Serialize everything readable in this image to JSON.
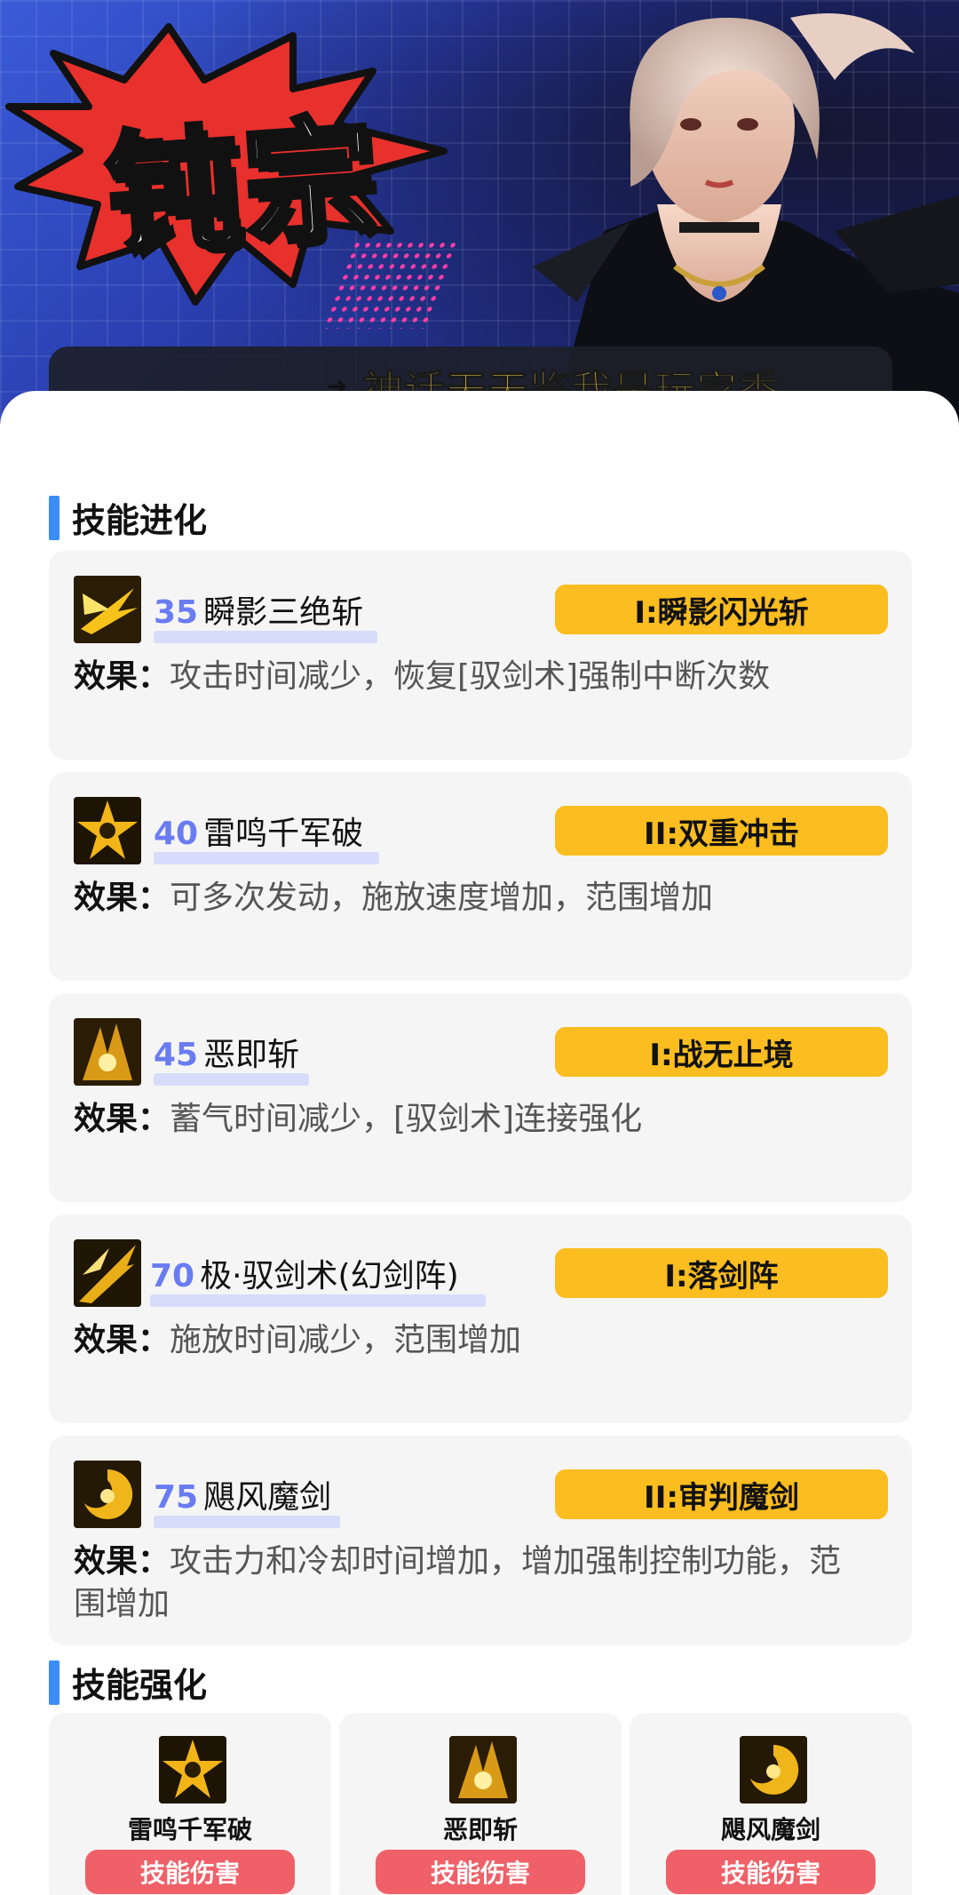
{
  "banner": {
    "title": "钝宗",
    "caption": "神话天天鉴我是玩家秀"
  },
  "sections": {
    "evolution_title": "技能进化",
    "enhance_title": "技能强化"
  },
  "effect_label": "效果：",
  "skills": [
    {
      "level": "35",
      "name": "瞬影三绝斩",
      "evolution": "I:瞬影闪光斩",
      "effect": "攻击时间减少，恢复[驭剑术]强制中断次数",
      "icon": "slash-burst-icon"
    },
    {
      "level": "40",
      "name": "雷鸣千军破",
      "evolution": "II:双重冲击",
      "effect": "可多次发动，施放速度增加，范围增加",
      "icon": "thunder-star-icon"
    },
    {
      "level": "45",
      "name": "恶即斩",
      "evolution": "I:战无止境",
      "effect": "蓄气时间减少，[驭剑术]连接强化",
      "icon": "evil-slash-icon"
    },
    {
      "level": "70",
      "name": "极·驭剑术(幻剑阵)",
      "evolution": "I:落剑阵",
      "effect": "施放时间减少，范围增加",
      "icon": "sword-array-icon"
    },
    {
      "level": "75",
      "name": "飓风魔剑",
      "evolution": "II:审判魔剑",
      "effect": "攻击力和冷却时间增加，增加强制控制功能，范围增加",
      "icon": "cyclone-sword-icon"
    }
  ],
  "enhancements": [
    {
      "name": "雷鸣千军破",
      "button": "技能伤害",
      "icon": "thunder-star-icon"
    },
    {
      "name": "恶即斩",
      "button": "技能伤害",
      "icon": "evil-slash-icon"
    },
    {
      "name": "飓风魔剑",
      "button": "技能伤害",
      "icon": "cyclone-sword-icon"
    }
  ],
  "colors": {
    "accent_blue": "#3a8ef6",
    "level_blue": "#6a7cf2",
    "badge_yellow": "#fbbd1f",
    "damage_red": "#ef6068"
  }
}
